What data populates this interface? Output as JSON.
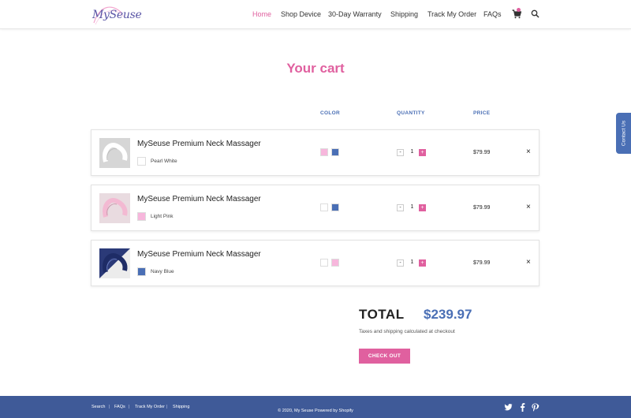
{
  "brand": {
    "logo_text": "MySeuse"
  },
  "nav": {
    "items": [
      "Home",
      "Shop Device",
      "30-Day Warranty",
      "Shipping",
      "Track My Order",
      "FAQs"
    ],
    "active": "Home"
  },
  "page": {
    "title": "Your cart"
  },
  "columns": {
    "color": "COLOR",
    "quantity": "QUANTITY",
    "price": "PRICE"
  },
  "cart": {
    "items": [
      {
        "name": "MySeuse Premium Neck Massager",
        "variant": "Pearl White",
        "variant_color": "#ffffff",
        "color_options": [
          "#f7b6dc",
          "#4a6fb5"
        ],
        "quantity": "1",
        "price": "$79.99",
        "remove": "×",
        "minus": "-",
        "plus": "+"
      },
      {
        "name": "MySeuse Premium Neck Massager",
        "variant": "Light Pink",
        "variant_color": "#f7b6dc",
        "color_options": [
          "#ffffff",
          "#4a6fb5"
        ],
        "quantity": "1",
        "price": "$79.99",
        "remove": "×",
        "minus": "-",
        "plus": "+"
      },
      {
        "name": "MySeuse Premium Neck Massager",
        "variant": "Navy Blue",
        "variant_color": "#4a6fb5",
        "color_options": [
          "#ffffff",
          "#f7b6dc"
        ],
        "quantity": "1",
        "price": "$79.99",
        "remove": "×",
        "minus": "-",
        "plus": "+"
      }
    ]
  },
  "summary": {
    "total_label": "TOTAL",
    "total_value": "$239.97",
    "tax_note": "Taxes and shipping calculated at checkout",
    "checkout_label": "CHECK OUT"
  },
  "contact_tab": {
    "label": "Contact Us"
  },
  "footer": {
    "links": [
      "Search",
      "FAQs",
      "Track My Order",
      "Shipping"
    ],
    "copyright": "© 2020, My Seuse Powered by Shopify",
    "social_icons": [
      "twitter-icon",
      "facebook-icon",
      "pinterest-icon"
    ]
  },
  "colors": {
    "accent_pink": "#e0609f",
    "accent_blue": "#4a6fb5",
    "footer_bg": "#3f5a98"
  },
  "icons": {
    "cart": "cart-icon",
    "search": "search-icon"
  }
}
